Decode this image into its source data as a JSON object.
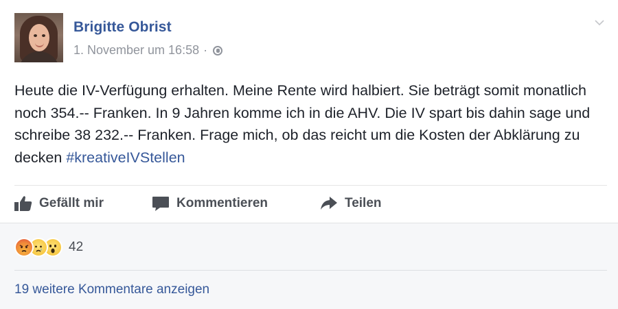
{
  "post": {
    "author": "Brigitte Obrist",
    "timestamp": "1. November um 16:58",
    "separator": "·",
    "privacy_icon": "globe-icon",
    "body_text": "Heute die IV-Verfügung erhalten. Meine Rente wird halbiert. Sie beträgt somit monatlich noch 354.-- Franken. In 9 Jahren komme ich in die AHV. Die IV spart bis dahin sage und schreibe 38 232.-- Franken. Frage mich, ob das reicht um die Kosten der Abklärung zu decken ",
    "hashtag": "#kreativeIVStellen"
  },
  "actions": {
    "like": "Gefällt mir",
    "comment": "Kommentieren",
    "share": "Teilen"
  },
  "reactions": {
    "icons": [
      "angry-reaction-icon",
      "sad-reaction-icon",
      "wow-reaction-icon"
    ],
    "count": "42"
  },
  "comments": {
    "more_label": "19 weitere Kommentare anzeigen"
  },
  "colors": {
    "link_blue": "#365899",
    "meta_gray": "#90949c",
    "action_gray": "#4b4f56",
    "footer_bg": "#f6f7f9"
  }
}
